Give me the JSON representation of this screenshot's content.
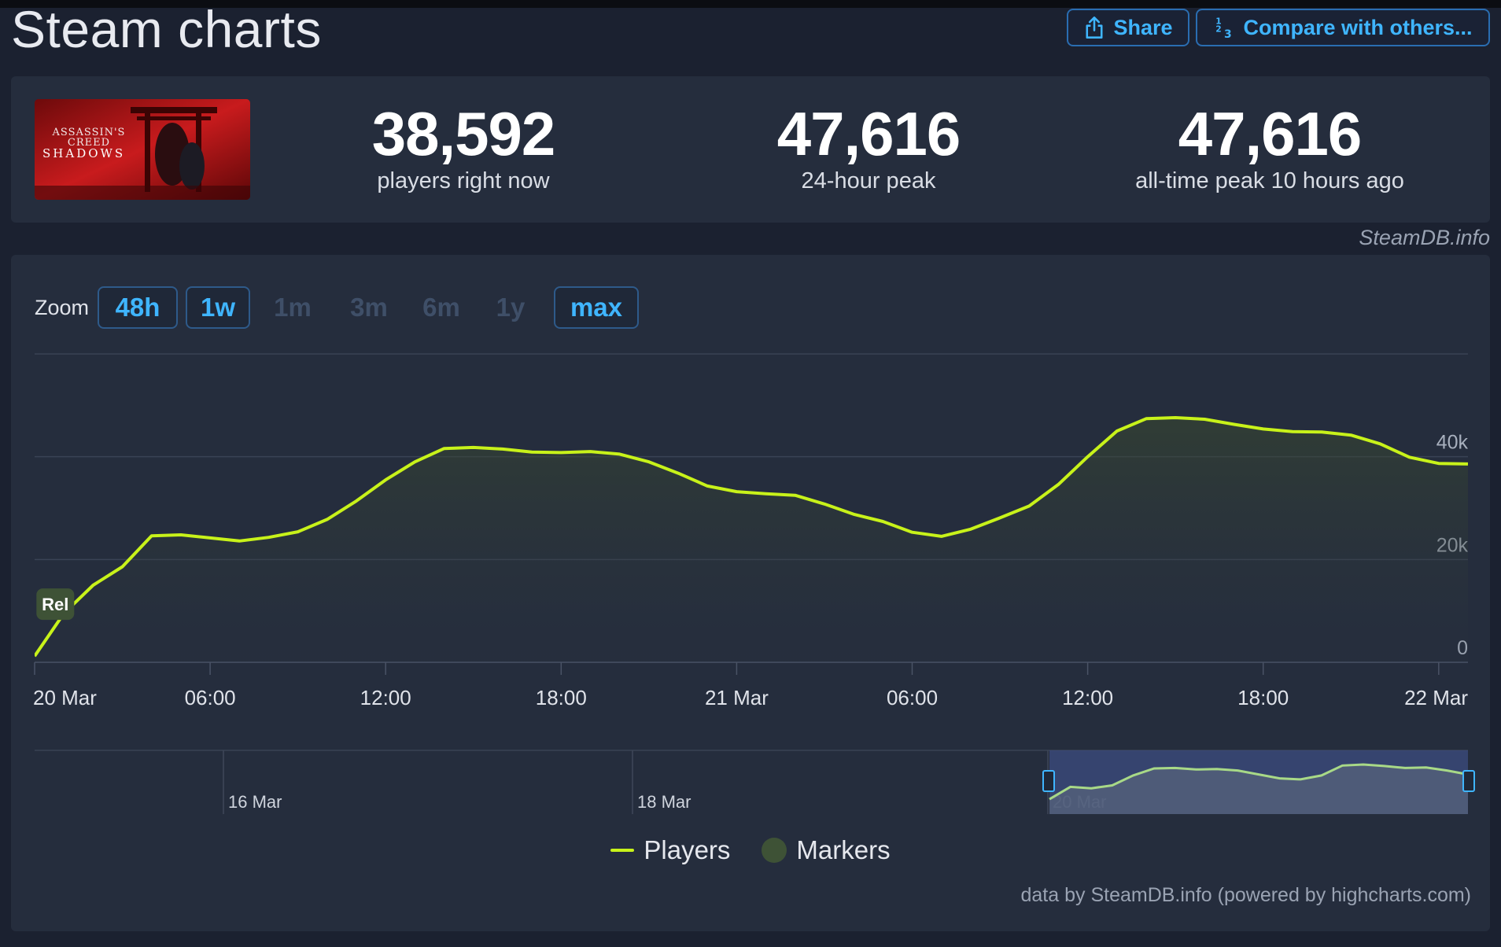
{
  "page": {
    "title": "Steam charts"
  },
  "toolbar": {
    "share_label": "Share",
    "compare_label": "Compare with others..."
  },
  "game": {
    "logo_top": "ASSASSIN'S CREED",
    "logo_bottom": "SHADOWS"
  },
  "stats": [
    {
      "value": "38,592",
      "label": "players right now"
    },
    {
      "value": "47,616",
      "label": "24-hour peak"
    },
    {
      "value": "47,616",
      "label": "all-time peak 10 hours ago"
    }
  ],
  "credit_top": "SteamDB.info",
  "zoom": {
    "label": "Zoom",
    "options": [
      {
        "label": "48h",
        "state": "active"
      },
      {
        "label": "1w",
        "state": "active"
      },
      {
        "label": "1m",
        "state": "disabled"
      },
      {
        "label": "3m",
        "state": "disabled"
      },
      {
        "label": "6m",
        "state": "disabled"
      },
      {
        "label": "1y",
        "state": "disabled"
      },
      {
        "label": "max",
        "state": "active"
      }
    ]
  },
  "chart_data": {
    "type": "area",
    "x_unit": "hours since 20 Mar 00:00",
    "x_ticks": [
      {
        "x": 0,
        "label": "20 Mar"
      },
      {
        "x": 6,
        "label": "06:00"
      },
      {
        "x": 12,
        "label": "12:00"
      },
      {
        "x": 18,
        "label": "18:00"
      },
      {
        "x": 24,
        "label": "21 Mar"
      },
      {
        "x": 30,
        "label": "06:00"
      },
      {
        "x": 36,
        "label": "12:00"
      },
      {
        "x": 42,
        "label": "18:00"
      },
      {
        "x": 48,
        "label": "22 Mar"
      }
    ],
    "y_ticks": [
      {
        "y": 0,
        "label": "0"
      },
      {
        "y": 20000,
        "label": "20k"
      },
      {
        "y": 40000,
        "label": "40k"
      }
    ],
    "ylim": [
      0,
      60000
    ],
    "xlim": [
      0,
      49
    ],
    "series": [
      {
        "name": "Players",
        "color": "#c8f21a",
        "x": [
          0,
          1,
          2,
          3,
          4,
          5,
          6,
          7,
          8,
          9,
          10,
          11,
          12,
          13,
          14,
          15,
          16,
          17,
          18,
          19,
          20,
          21,
          22,
          23,
          24,
          25,
          26,
          27,
          28,
          29,
          30,
          31,
          32,
          33,
          34,
          35,
          36,
          37,
          38,
          39,
          40,
          41,
          42,
          43,
          44,
          45,
          46,
          47,
          48,
          49
        ],
        "y": [
          1200,
          9500,
          15000,
          18600,
          24600,
          24800,
          24200,
          23600,
          24300,
          25400,
          27800,
          31400,
          35500,
          39000,
          41600,
          41800,
          41500,
          40900,
          40800,
          41000,
          40500,
          39000,
          36800,
          34300,
          33200,
          32800,
          32500,
          30800,
          28800,
          27400,
          25300,
          24500,
          25900,
          28100,
          30400,
          34600,
          40000,
          45000,
          47400,
          47600,
          47300,
          46300,
          45400,
          44900,
          44800,
          44200,
          42500,
          39900,
          38700,
          38592
        ]
      }
    ],
    "markers": [
      {
        "x": 0.6,
        "label": "Rel"
      }
    ],
    "navigator": {
      "ticks": [
        "16 Mar",
        "18 Mar",
        "20 Mar"
      ],
      "shape": [
        0.3,
        0.55,
        0.52,
        0.58,
        0.78,
        0.92,
        0.93,
        0.9,
        0.91,
        0.88,
        0.8,
        0.72,
        0.7,
        0.78,
        0.98,
        1.0,
        0.97,
        0.93,
        0.94,
        0.88,
        0.8
      ]
    },
    "legend": [
      "Players",
      "Markers"
    ],
    "legend_position": "bottom-center"
  },
  "credit_bottom": "data by SteamDB.info (powered by highcharts.com)"
}
